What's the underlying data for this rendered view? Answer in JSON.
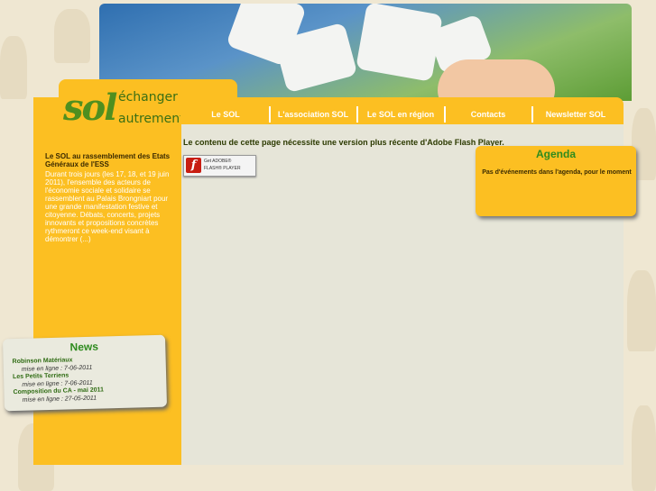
{
  "logo": {
    "brand": "sol",
    "word1": "échanger",
    "word2": "autrement"
  },
  "nav": {
    "items": [
      "Le SOL",
      "L'association SOL",
      "Le SOL en région",
      "Contacts",
      "Newsletter SOL"
    ]
  },
  "content": {
    "flash_message": "Le contenu de cette page nécessite une version plus récente d'Adobe Flash Player.",
    "flash_button": {
      "line1": "Get ADOBE®",
      "line2": "FLASH® PLAYER"
    }
  },
  "agenda": {
    "title": "Agenda",
    "text": "Pas d'événements dans l'agenda, pour le moment"
  },
  "sidebar": {
    "title": "Le SOL au rassemblement des Etats Généraux de l'ESS",
    "text": "Durant trois jours (les 17, 18, et 19 juin 2011), l'ensemble des acteurs de l'économie sociale et solidaire se rassemblent au Palais Brongniart pour une grande manifestation festive et citoyenne. Débats, concerts, projets innovants et propositions concrètes rythmeront ce week-end visant à démontrer (...)"
  },
  "news": {
    "title": "News",
    "items": [
      {
        "label": "Robinson Matériaux",
        "date": "mise en ligne : 7-06-2011"
      },
      {
        "label": "Les Petits Terriens",
        "date": "mise en ligne : 7-06-2011"
      },
      {
        "label": "Composition du CA - mai 2011",
        "date": "mise en ligne : 27-05-2011"
      }
    ]
  },
  "colors": {
    "accent": "#fcbf22",
    "green": "#2e8b1e",
    "content_bg": "#e6e5d8"
  }
}
